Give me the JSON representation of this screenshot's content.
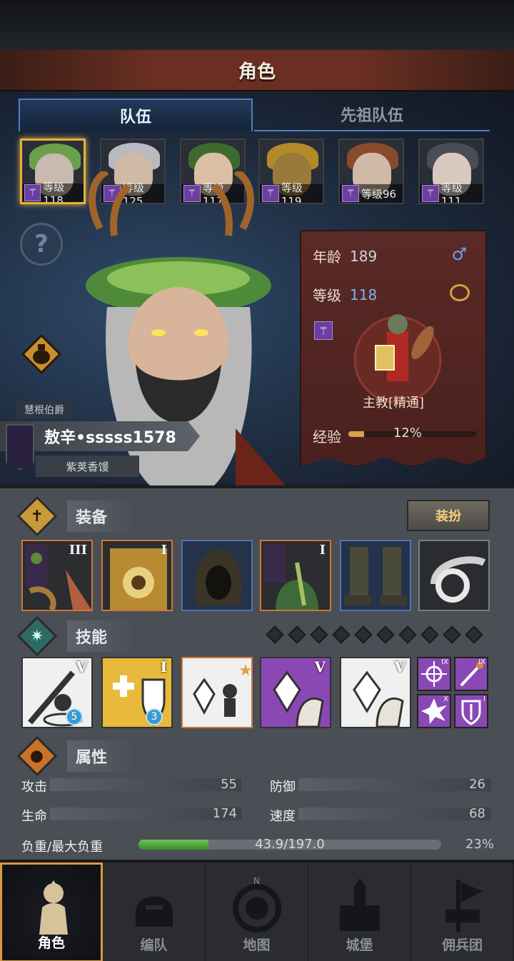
{
  "header": {
    "title": "角色"
  },
  "tabs": [
    {
      "label": "队伍",
      "active": true
    },
    {
      "label": "先祖队伍",
      "active": false
    }
  ],
  "party": [
    {
      "level_text": "等级118",
      "selected": true
    },
    {
      "level_text": "等级125"
    },
    {
      "level_text": "等级117"
    },
    {
      "level_text": "等级119"
    },
    {
      "level_text": "等级96"
    },
    {
      "level_text": "等级111"
    }
  ],
  "hero": {
    "family_tag": "慧根伯爵",
    "name": "敖辛•sssss1578",
    "subtitle": "紫荚香馒"
  },
  "info": {
    "age_label": "年龄",
    "age": "189",
    "level_label": "等级",
    "level": "118",
    "class_name": "主教[精通]",
    "exp_label": "经验",
    "exp_percent": "12%",
    "exp_fraction": 0.12
  },
  "equipment": {
    "section_label": "装备",
    "dress_button": "装扮",
    "slots": [
      {
        "name": "banner-weapon",
        "tier": "III"
      },
      {
        "name": "holy-book",
        "tier": "I"
      },
      {
        "name": "hood",
        "tier": ""
      },
      {
        "name": "leaf-armor",
        "tier": "I"
      },
      {
        "name": "boots",
        "tier": ""
      },
      {
        "name": "ring-trinket",
        "tier": ""
      }
    ]
  },
  "skills": {
    "section_label": "技能",
    "cards": [
      {
        "tier": "V",
        "badge": "5"
      },
      {
        "tier": "I",
        "badge": "3"
      },
      {
        "tier": "",
        "badge": ""
      },
      {
        "tier": "V",
        "badge": ""
      },
      {
        "tier": "V",
        "badge": ""
      }
    ],
    "mini": [
      {
        "tier": "IX"
      },
      {
        "tier": "IX"
      },
      {
        "tier": "X"
      },
      {
        "tier": "I"
      }
    ]
  },
  "attributes": {
    "section_label": "属性",
    "attack_label": "攻击",
    "attack": "55",
    "defense_label": "防御",
    "defense": "26",
    "hp_label": "生命",
    "hp": "174",
    "speed_label": "速度",
    "speed": "68",
    "load_label": "负重/最大负重",
    "load": "43.9/197.0",
    "load_percent": "23%",
    "load_fraction": 0.23
  },
  "nav": [
    {
      "label": "角色",
      "active": true
    },
    {
      "label": "编队"
    },
    {
      "label": "地图"
    },
    {
      "label": "城堡"
    },
    {
      "label": "佣兵团"
    }
  ],
  "colors": {
    "accent_gold": "#e2b23d",
    "tab_blue": "#4d7fc2",
    "exp_fill": "#d6a24a",
    "load_fill": "#4fa83e"
  }
}
